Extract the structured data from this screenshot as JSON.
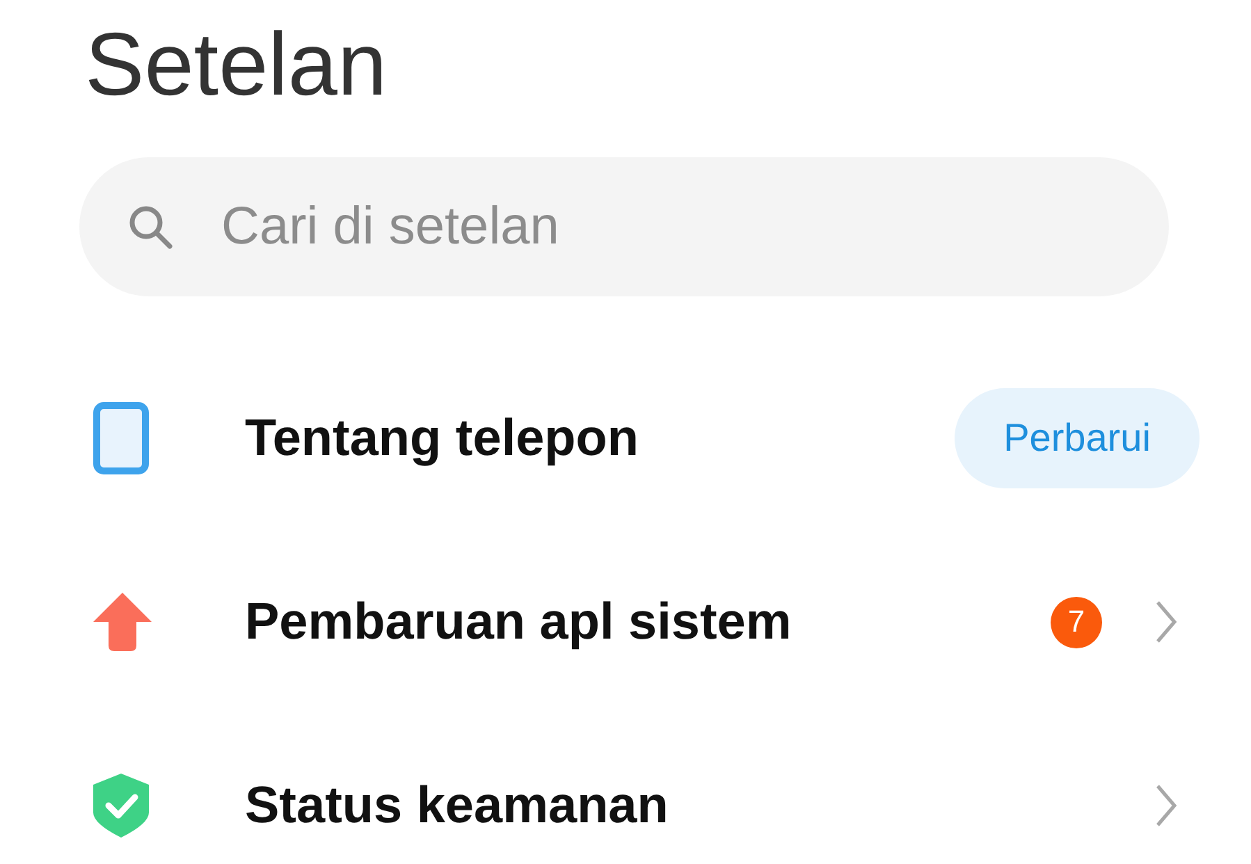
{
  "title": "Setelan",
  "search": {
    "placeholder": "Cari di setelan"
  },
  "items": [
    {
      "label": "Tentang telepon",
      "kind": "button",
      "action": "Perbarui"
    },
    {
      "label": "Pembaruan apl sistem",
      "kind": "chevron",
      "badge": "7"
    },
    {
      "label": "Status keamanan",
      "kind": "chevron"
    }
  ]
}
